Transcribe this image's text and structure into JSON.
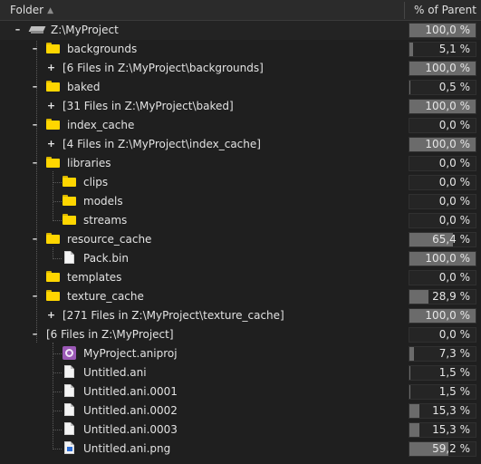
{
  "header": {
    "folder_label": "Folder",
    "pct_label": "% of Parent"
  },
  "rows": [
    {
      "label": "Z:\\MyProject",
      "pct": "100,0 %",
      "fill": 1.0
    },
    {
      "label": "backgrounds",
      "pct": "5,1 %",
      "fill": 0.051
    },
    {
      "label": "[6 Files in Z:\\MyProject\\backgrounds]",
      "pct": "100,0 %",
      "fill": 1.0
    },
    {
      "label": "baked",
      "pct": "0,5 %",
      "fill": 0.005
    },
    {
      "label": "[31 Files in Z:\\MyProject\\baked]",
      "pct": "100,0 %",
      "fill": 1.0
    },
    {
      "label": "index_cache",
      "pct": "0,0 %",
      "fill": 0.0
    },
    {
      "label": "[4 Files in Z:\\MyProject\\index_cache]",
      "pct": "100,0 %",
      "fill": 1.0
    },
    {
      "label": "libraries",
      "pct": "0,0 %",
      "fill": 0.0
    },
    {
      "label": "clips",
      "pct": "0,0 %",
      "fill": 0.0
    },
    {
      "label": "models",
      "pct": "0,0 %",
      "fill": 0.0
    },
    {
      "label": "streams",
      "pct": "0,0 %",
      "fill": 0.0
    },
    {
      "label": "resource_cache",
      "pct": "65,4 %",
      "fill": 0.654
    },
    {
      "label": "Pack.bin",
      "pct": "100,0 %",
      "fill": 1.0
    },
    {
      "label": "templates",
      "pct": "0,0 %",
      "fill": 0.0
    },
    {
      "label": "texture_cache",
      "pct": "28,9 %",
      "fill": 0.289
    },
    {
      "label": "[271 Files in Z:\\MyProject\\texture_cache]",
      "pct": "100,0 %",
      "fill": 1.0
    },
    {
      "label": "[6 Files in Z:\\MyProject]",
      "pct": "0,0 %",
      "fill": 0.0
    },
    {
      "label": "MyProject.aniproj",
      "pct": "7,3 %",
      "fill": 0.073
    },
    {
      "label": "Untitled.ani",
      "pct": "1,5 %",
      "fill": 0.015
    },
    {
      "label": "Untitled.ani.0001",
      "pct": "1,5 %",
      "fill": 0.015
    },
    {
      "label": "Untitled.ani.0002",
      "pct": "15,3 %",
      "fill": 0.153
    },
    {
      "label": "Untitled.ani.0003",
      "pct": "15,3 %",
      "fill": 0.153
    },
    {
      "label": "Untitled.ani.png",
      "pct": "59,2 %",
      "fill": 0.592
    }
  ],
  "icons": {
    "drive": "drive-icon",
    "folder": "folder-icon",
    "file": "file-icon",
    "aniproj": "aniproj-icon",
    "png": "image-file-icon"
  },
  "colors": {
    "folder": "#ffd600",
    "bar": "#6b6b6b",
    "aniproj": "#9b59b6",
    "background": "#1f1f1f"
  }
}
